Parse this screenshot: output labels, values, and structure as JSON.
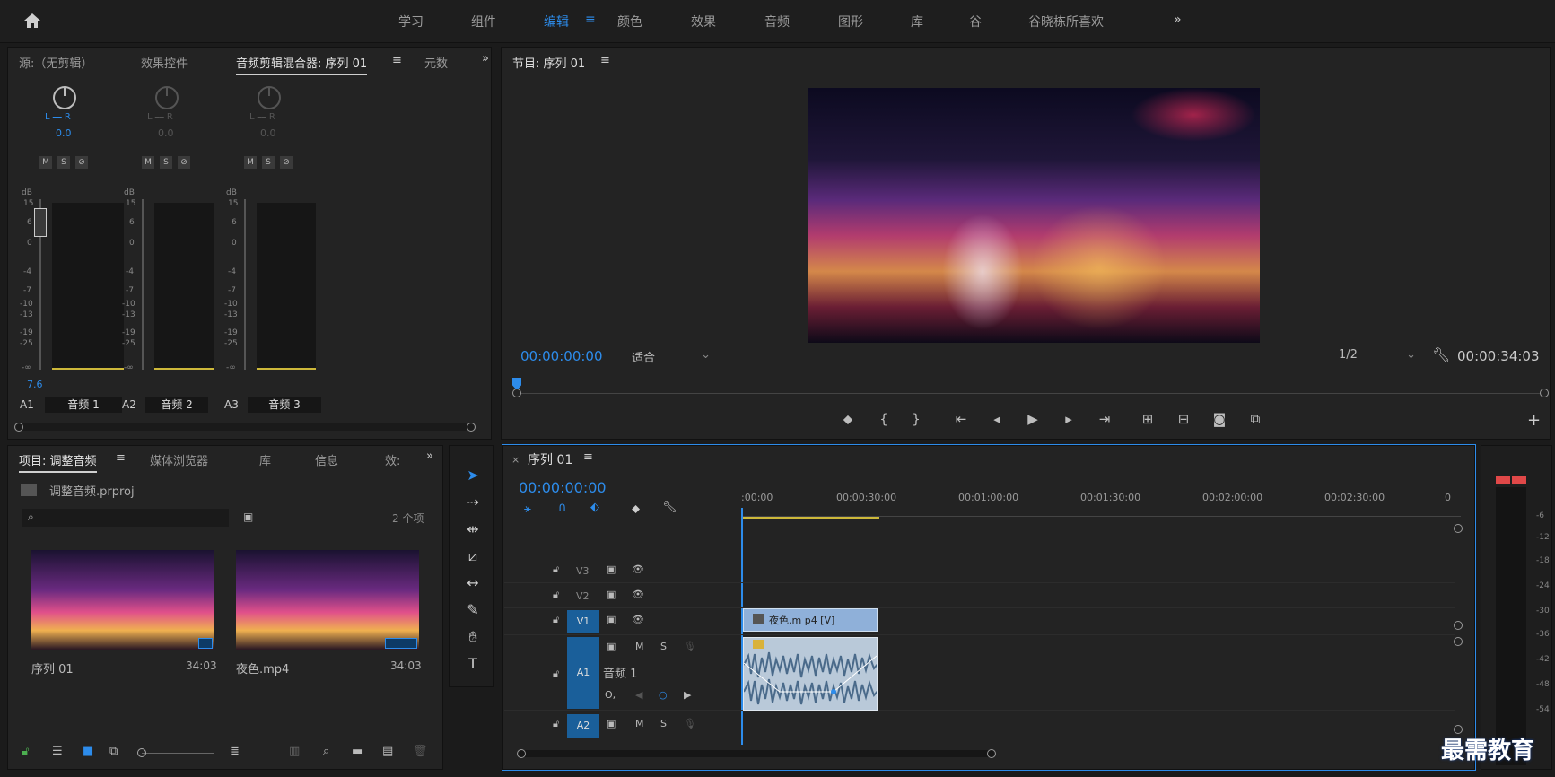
{
  "topnav": {
    "items": [
      "学习",
      "组件",
      "编辑",
      "颜色",
      "效果",
      "音频",
      "图形",
      "库",
      "谷",
      "谷晓栋所喜欢"
    ],
    "active": "编辑",
    "overflow": "»"
  },
  "source_panel": {
    "tabs": [
      "源:（无剪辑）",
      "效果控件",
      "音频剪辑混合器: 序列 01",
      "元数据"
    ],
    "tabs_display": [
      "源:（无剪辑）",
      "效果控件",
      "音频剪辑混合器: 序列 01",
      "元数"
    ],
    "active": "音频剪辑混合器: 序列 01",
    "overflow": "»"
  },
  "mixer": {
    "channels": [
      {
        "id": "A1",
        "name": "音频 1",
        "pan": "0.0",
        "level": "7.6",
        "active": true
      },
      {
        "id": "A2",
        "name": "音频 2",
        "pan": "0.0",
        "active": false
      },
      {
        "id": "A3",
        "name": "音频 3",
        "pan": "0.0",
        "active": false
      }
    ],
    "lr_label": "L ⎯⎯ R",
    "db_label": "dB",
    "scale": [
      "15",
      "6",
      "0",
      "-4",
      "-7",
      "-10",
      "-13",
      "-19",
      "-25",
      "-∞"
    ],
    "ms": [
      "M",
      "S",
      "⊘"
    ]
  },
  "program": {
    "title": "节目: 序列 01",
    "timecode": "00:00:00:00",
    "fit": "适合",
    "resolution": "1/2",
    "duration": "00:00:34:03"
  },
  "project": {
    "tabs": [
      "项目: 调整音频",
      "媒体浏览器",
      "库",
      "信息",
      "效果"
    ],
    "tabs_display": [
      "项目: 调整音频",
      "媒体浏览器",
      "库",
      "信息",
      "效:"
    ],
    "file": "调整音频.prproj",
    "count": "2 个项",
    "items": [
      {
        "name": "序列 01",
        "duration": "34:03"
      },
      {
        "name": "夜色.mp4",
        "duration": "34:03"
      }
    ]
  },
  "timeline": {
    "title": "序列 01",
    "timecode": "00:00:00:00",
    "ruler": [
      ":00:00",
      "00:00:30:00",
      "00:01:00:00",
      "00:01:30:00",
      "00:02:00:00",
      "00:02:30:00",
      "0"
    ],
    "tracks": [
      "V3",
      "V2",
      "V1",
      "A1",
      "A2"
    ],
    "audio_track_name": "音频 1",
    "clip_label": "夜色.mp4 [V]",
    "clip_display": "夜色.m p4 [V]"
  },
  "meters_scale": [
    "-6",
    "-12",
    "-18",
    "-24",
    "-30",
    "-36",
    "-42",
    "-48",
    "-54"
  ],
  "watermark": "最需教育",
  "colors": {
    "accent": "#2d8ceb",
    "panel": "#232323"
  }
}
